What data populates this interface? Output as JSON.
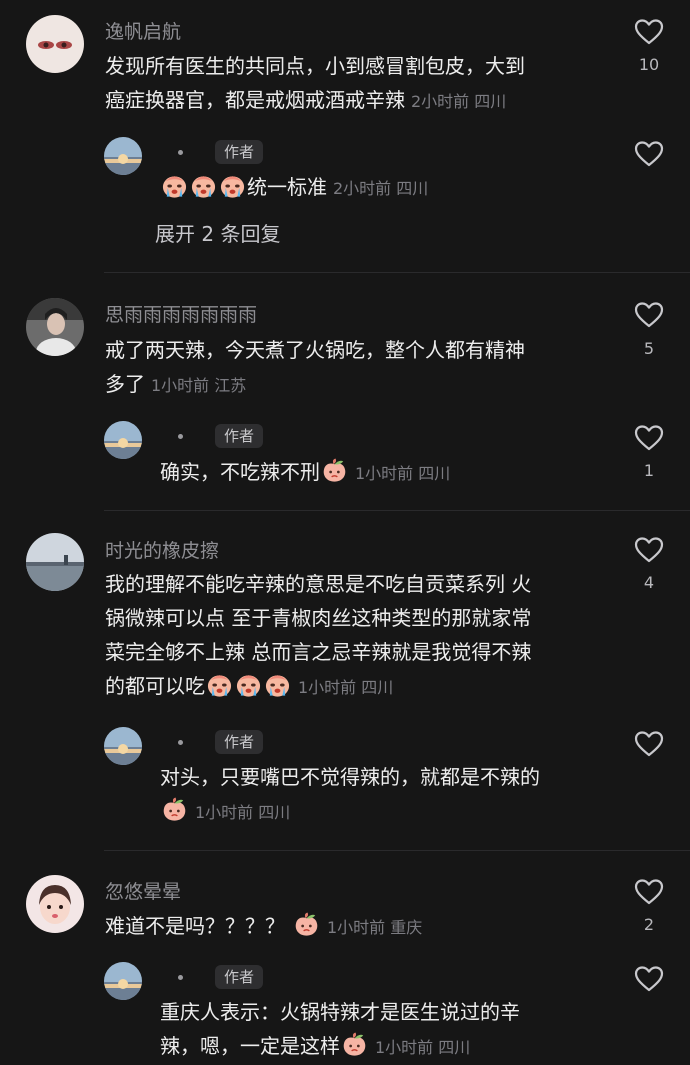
{
  "comments": [
    {
      "user": "逸帆启航",
      "text": "发现所有医生的共同点，小到感冒割包皮，大到癌症换器官，都是戒烟戒酒戒辛辣",
      "line1": "发现所有医生的共同点，小到感冒割包皮，大到",
      "line2": "癌症换器官，都是戒烟戒酒戒辛辣",
      "meta": "2小时前 四川",
      "likes": "10",
      "reply": {
        "badge": "作者",
        "text": "统一标准",
        "emojis": [
          "crying-face",
          "crying-face",
          "crying-face"
        ],
        "meta": "2小时前 四川",
        "likes": "",
        "expand": "展开 2 条回复"
      }
    },
    {
      "user": "思雨雨雨雨雨雨雨",
      "line1": "戒了两天辣，今天煮了火锅吃，整个人都有精神",
      "line2": "多了",
      "meta": "1小时前 江苏",
      "likes": "5",
      "reply": {
        "badge": "作者",
        "text": "确实，不吃辣不刑",
        "emojis": [
          "peach-face"
        ],
        "meta": "1小时前 四川",
        "likes": "1"
      }
    },
    {
      "user": "时光的橡皮擦",
      "line1": "我的理解不能吃辛辣的意思是不吃自贡菜系列 火",
      "line2": "锅微辣可以点 至于青椒肉丝这种类型的那就家常",
      "line3": "菜完全够不上辣 总而言之忌辛辣就是我觉得不辣",
      "line4": "的都可以吃",
      "emojis": [
        "crying-face",
        "crying-face",
        "crying-face"
      ],
      "meta": "1小时前 四川",
      "likes": "4",
      "reply": {
        "badge": "作者",
        "text": "对头，只要嘴巴不觉得辣的，就都是不辣的",
        "emojis": [
          "peach-face"
        ],
        "meta": "1小时前 四川",
        "likes": ""
      }
    },
    {
      "user": "忽悠晕晕",
      "text": "难道不是吗？？？？",
      "emojis": [
        "peach-face"
      ],
      "meta": "1小时前 重庆",
      "likes": "2",
      "reply": {
        "badge": "作者",
        "line1": "重庆人表示：火锅特辣才是医生说过的辛",
        "line2": "辣，嗯，一定是这样",
        "emojis": [
          "peach-face"
        ],
        "meta": "1小时前 四川",
        "likes": ""
      }
    }
  ],
  "colors": {
    "background": "#161616",
    "text": "#ededed",
    "muted": "#8e8e93"
  }
}
